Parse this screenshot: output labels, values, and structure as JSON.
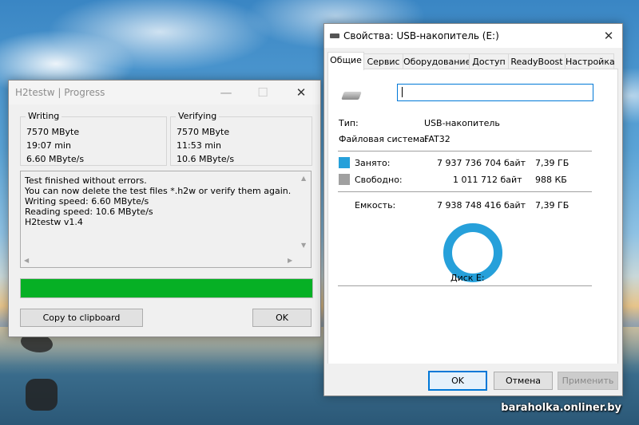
{
  "colors": {
    "progress": "#06b025",
    "used": "#26a0da",
    "free": "#a0a0a0",
    "focus": "#0078d7"
  },
  "h2testw": {
    "title": "H2testw | Progress",
    "controls": {
      "minimize": "—",
      "maximize": "☐",
      "close": "✕"
    },
    "writing": {
      "label": "Writing",
      "lines": [
        "7570 MByte",
        "19:07 min",
        "6.60 MByte/s"
      ]
    },
    "verifying": {
      "label": "Verifying",
      "lines": [
        "7570 MByte",
        "11:53 min",
        "10.6 MByte/s"
      ]
    },
    "log": [
      "Test finished without errors.",
      "You can now delete the test files *.h2w or verify them again.",
      "Writing speed: 6.60 MByte/s",
      "Reading speed: 10.6 MByte/s",
      "H2testw v1.4"
    ],
    "progress_fraction": 1.0,
    "copy_button": "Copy to clipboard",
    "ok_button": "OK",
    "icons": {
      "scroll_up": "▲",
      "scroll_down": "▼",
      "scroll_left": "◀",
      "scroll_right": "▶"
    }
  },
  "props": {
    "title": "Свойства: USB-накопитель (E:)",
    "close": "✕",
    "tabs": [
      "Общие",
      "Сервис",
      "Оборудование",
      "Доступ",
      "ReadyBoost",
      "Настройка"
    ],
    "active_tab": 0,
    "name_value": "",
    "type_label": "Тип:",
    "type_value": "USB-накопитель",
    "fs_label": "Файловая система:",
    "fs_value": "FAT32",
    "used_label": "Занято:",
    "used_bytes": "7 937 736 704 байт",
    "used_size": "7,39 ГБ",
    "free_label": "Свободно:",
    "free_bytes": "1 011 712 байт",
    "free_size": "988 КБ",
    "capacity_label": "Емкость:",
    "capacity_bytes": "7 938 748 416 байт",
    "capacity_size": "7,39 ГБ",
    "disk_label": "Диск E:",
    "ok": "OK",
    "cancel": "Отмена",
    "apply": "Применить"
  },
  "watermark": "baraholka.onliner.by"
}
